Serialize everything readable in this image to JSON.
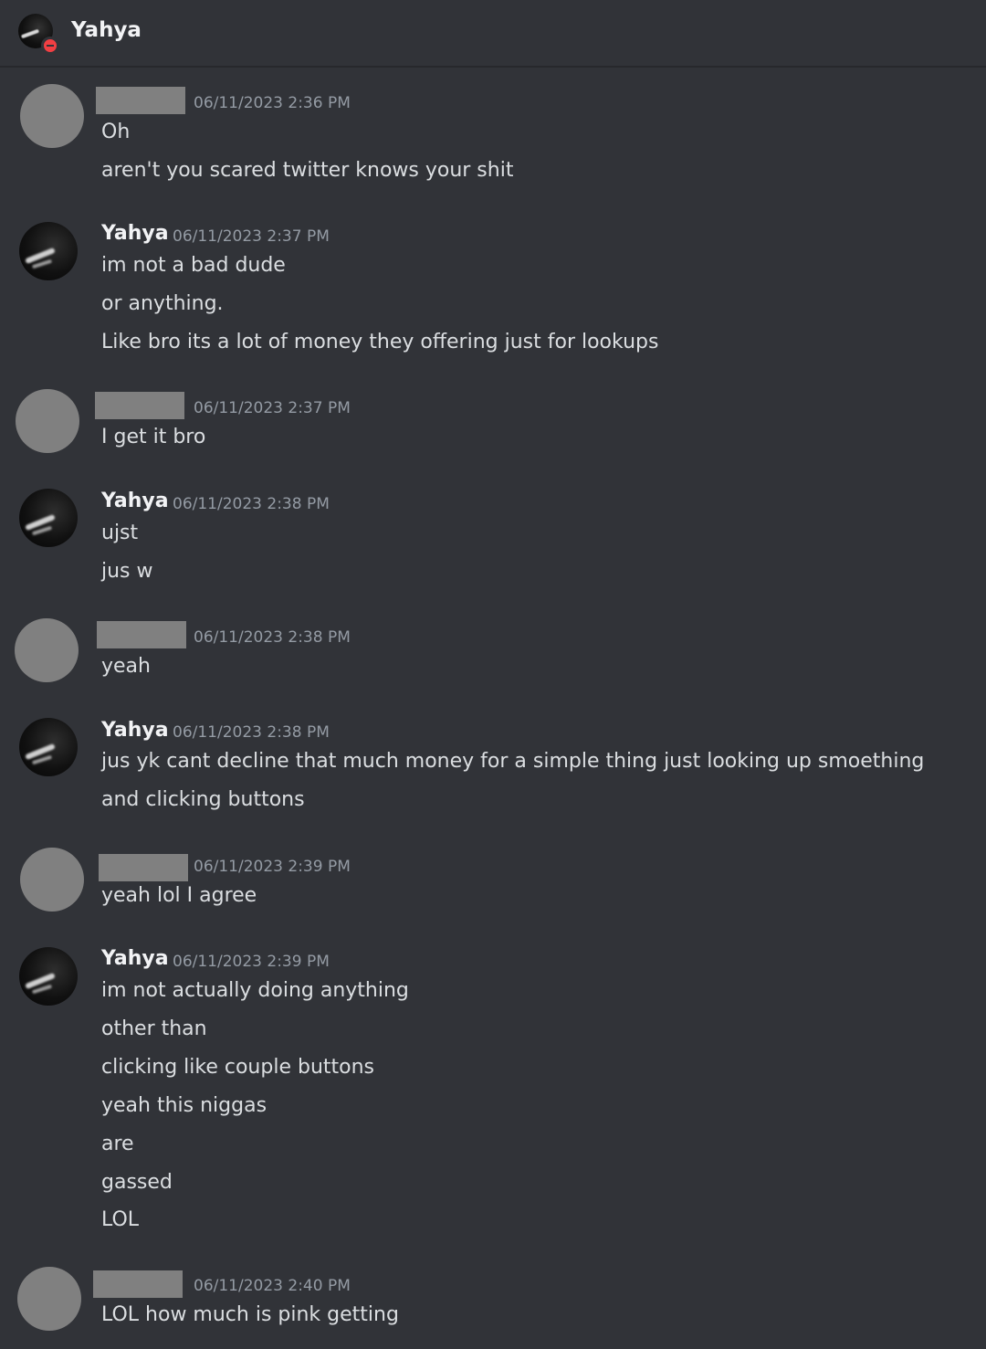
{
  "header": {
    "title": "Yahya",
    "status": "do-not-disturb"
  },
  "messages": [
    {
      "author": "",
      "redacted": true,
      "timestamp": "06/11/2023 2:36 PM",
      "lines": [
        "Oh",
        "aren't you scared twitter knows your shit"
      ]
    },
    {
      "author": "Yahya",
      "redacted": false,
      "timestamp": "06/11/2023 2:37 PM",
      "lines": [
        "im not a bad dude",
        "or anything.",
        "Like bro its a lot of money they offering just for lookups"
      ]
    },
    {
      "author": "",
      "redacted": true,
      "timestamp": "06/11/2023 2:37 PM",
      "lines": [
        "I get it bro"
      ]
    },
    {
      "author": "Yahya",
      "redacted": false,
      "timestamp": "06/11/2023 2:38 PM",
      "lines": [
        "ujst",
        "jus w"
      ]
    },
    {
      "author": "",
      "redacted": true,
      "timestamp": "06/11/2023 2:38 PM",
      "lines": [
        "yeah"
      ]
    },
    {
      "author": "Yahya",
      "redacted": false,
      "timestamp": "06/11/2023 2:38 PM",
      "lines": [
        "jus yk cant decline that much money for a simple thing just looking up smoething",
        "and clicking buttons"
      ]
    },
    {
      "author": "",
      "redacted": true,
      "timestamp": "06/11/2023 2:39 PM",
      "lines": [
        "yeah lol I agree"
      ]
    },
    {
      "author": "Yahya",
      "redacted": false,
      "timestamp": "06/11/2023 2:39 PM",
      "lines": [
        "im not actually doing anything",
        "other than",
        "clicking like couple buttons",
        "yeah this niggas",
        "are",
        "gassed",
        "LOL"
      ]
    },
    {
      "author": "",
      "redacted": true,
      "timestamp": "06/11/2023 2:40 PM",
      "lines": [
        "LOL how much is pink getting"
      ]
    }
  ],
  "colors": {
    "background": "#313338",
    "text": "#dbdee1",
    "timestamp": "#949ba4",
    "redaction": "#808080",
    "dnd": "#f23f43"
  }
}
